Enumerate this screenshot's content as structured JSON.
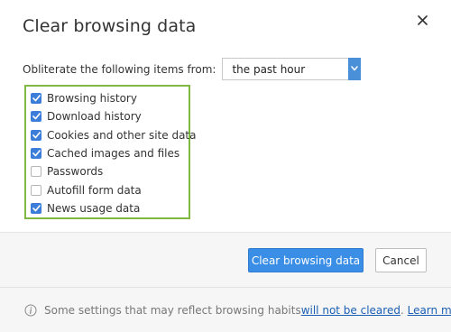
{
  "dialog": {
    "title": "Clear browsing data",
    "close_icon": "close-icon"
  },
  "obliterate": {
    "label": "Obliterate the following items from:",
    "selected": "the past hour"
  },
  "checkboxes": [
    {
      "label": "Browsing history",
      "checked": true
    },
    {
      "label": "Download history",
      "checked": true
    },
    {
      "label": "Cookies and other site data",
      "checked": true
    },
    {
      "label": "Cached images and files",
      "checked": true
    },
    {
      "label": "Passwords",
      "checked": false
    },
    {
      "label": "Autofill form data",
      "checked": false
    },
    {
      "label": "News usage data",
      "checked": true
    }
  ],
  "buttons": {
    "clear": "Clear browsing data",
    "cancel": "Cancel"
  },
  "info": {
    "text_before": "Some settings that may reflect browsing habits ",
    "link1": "will not be cleared",
    "separator": ". ",
    "link2": "Learn more"
  },
  "colors": {
    "accent": "#3a8ee6",
    "highlight_border": "#7fb842",
    "checkbox_checked": "#3b7dd8"
  }
}
